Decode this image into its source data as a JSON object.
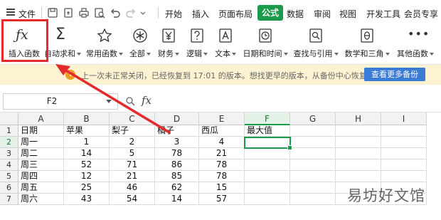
{
  "menu": {
    "file_label": "文件",
    "tabs": [
      "开始",
      "插入",
      "页面布局",
      "公式",
      "数据",
      "审阅",
      "视图",
      "开发工具",
      "会员专享"
    ],
    "active_tab": "公式"
  },
  "ribbon": {
    "buttons": [
      {
        "label": "插入函数",
        "icon": "fx-icon"
      },
      {
        "label": "自动求和",
        "icon": "sigma-icon"
      },
      {
        "label": "常用函数",
        "icon": "star-icon"
      },
      {
        "label": "全部",
        "icon": "asterisk-circle-icon"
      },
      {
        "label": "财务",
        "icon": "yen-icon"
      },
      {
        "label": "逻辑",
        "icon": "question-icon"
      },
      {
        "label": "文本",
        "icon": "text-a-icon"
      },
      {
        "label": "日期和时间",
        "icon": "clock-icon"
      },
      {
        "label": "查找与引用",
        "icon": "search-book-icon"
      },
      {
        "label": "数学和三角",
        "icon": "theta-icon"
      },
      {
        "label": "其他函数",
        "icon": "more-icon"
      }
    ]
  },
  "notification": {
    "text": "上一次未正常关闭，已经恢复到 17:01 的版本。想找更早的版本，从备份中心恢复",
    "button": "查看更多备份"
  },
  "formula_bar": {
    "name_box": "F2",
    "fx": "fx",
    "value": ""
  },
  "sheet": {
    "columns": [
      "A",
      "B",
      "C",
      "D",
      "E",
      "F",
      "G",
      "H",
      "I"
    ],
    "selected_column": "F",
    "selected_row": "2",
    "rows": [
      {
        "num": "1",
        "cells": [
          "日期",
          "苹果",
          "梨子",
          "橘子",
          "西瓜",
          "最大值",
          "",
          "",
          ""
        ]
      },
      {
        "num": "2",
        "cells": [
          "周一",
          "1",
          "2",
          "3",
          "4",
          "",
          "",
          "",
          ""
        ]
      },
      {
        "num": "3",
        "cells": [
          "周二",
          "14",
          "5",
          "78",
          "21",
          "",
          "",
          "",
          ""
        ]
      },
      {
        "num": "4",
        "cells": [
          "周三",
          "52",
          "71",
          "86",
          "78",
          "",
          "",
          "",
          ""
        ]
      },
      {
        "num": "5",
        "cells": [
          "周四",
          "12",
          "21",
          "85",
          "78",
          "",
          "",
          "",
          ""
        ]
      },
      {
        "num": "6",
        "cells": [
          "周五",
          "25",
          "46",
          "62",
          "15",
          "",
          "",
          "",
          ""
        ]
      },
      {
        "num": "7",
        "cells": [
          "周六",
          "43",
          "54",
          "14",
          "57",
          "",
          "",
          "",
          ""
        ]
      }
    ]
  },
  "watermark": "易坊好文馆",
  "colors": {
    "accent_green": "#1a9b4b",
    "highlight_red": "#e42a2a",
    "notice_bg": "#fdf3d2",
    "notice_button": "#3a7bd5"
  }
}
